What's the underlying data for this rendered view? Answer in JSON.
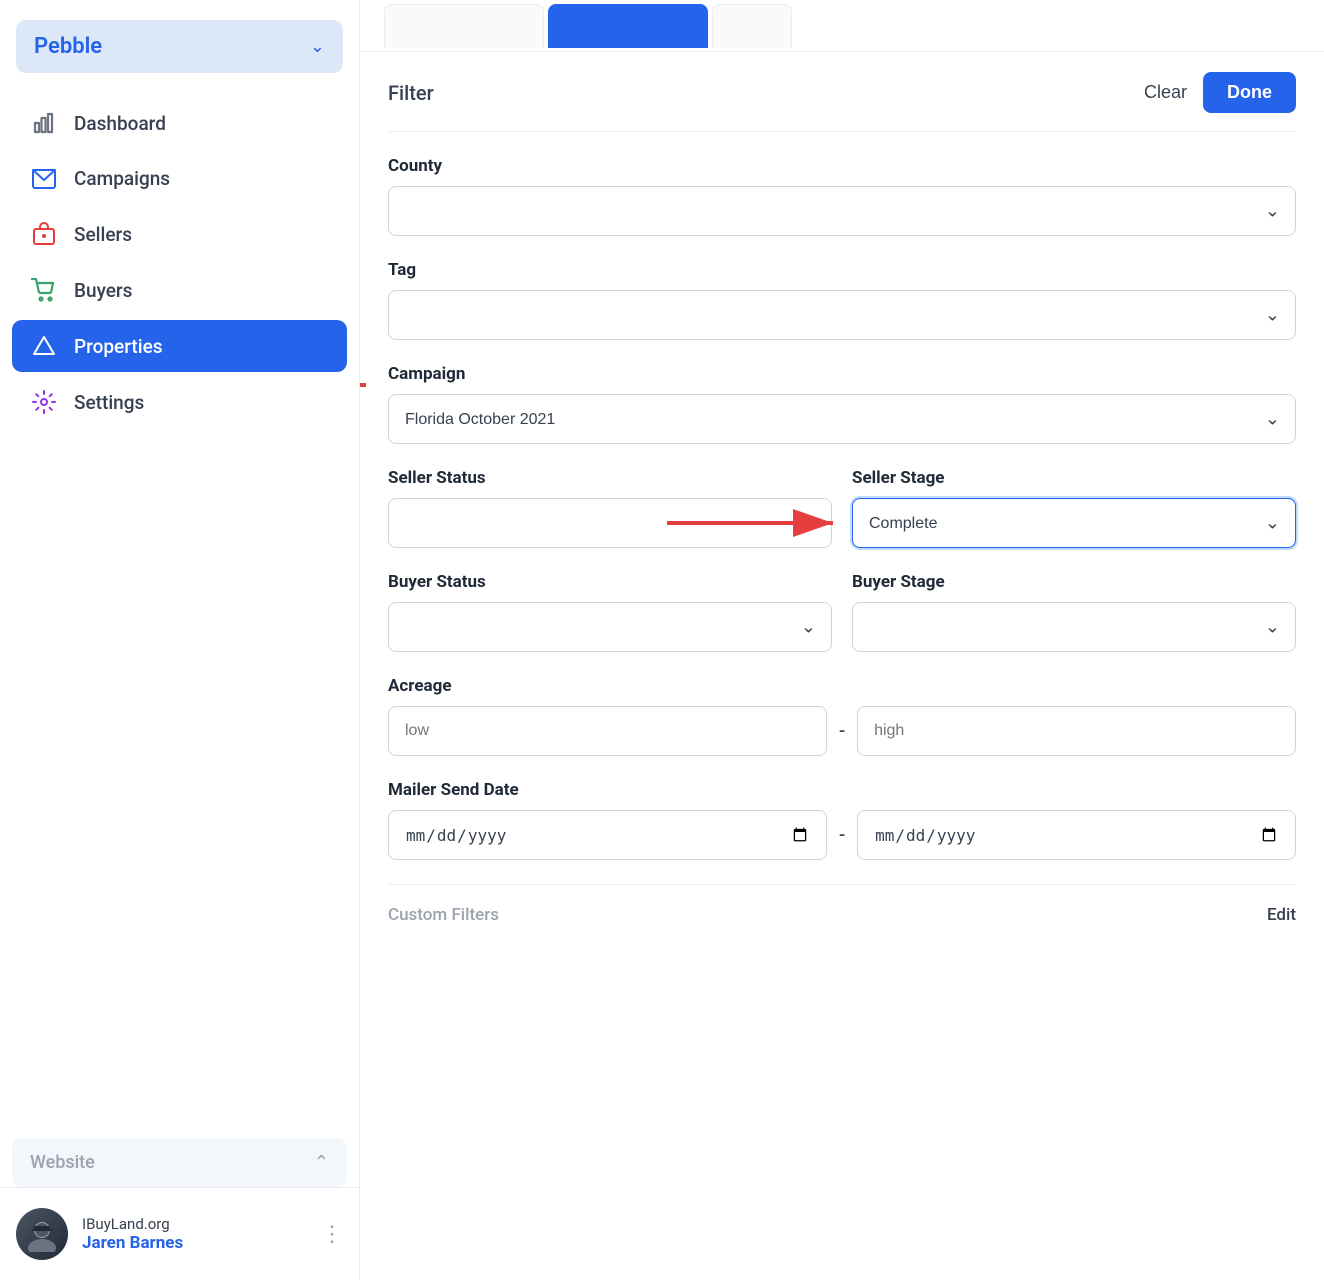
{
  "sidebar": {
    "brand": {
      "name": "Pebble",
      "chevron": "chevron-down"
    },
    "nav_items": [
      {
        "id": "dashboard",
        "label": "Dashboard",
        "icon": "bar-chart"
      },
      {
        "id": "campaigns",
        "label": "Campaigns",
        "icon": "mail"
      },
      {
        "id": "sellers",
        "label": "Sellers",
        "icon": "bag"
      },
      {
        "id": "buyers",
        "label": "Buyers",
        "icon": "cart"
      },
      {
        "id": "properties",
        "label": "Properties",
        "icon": "triangle",
        "active": true
      },
      {
        "id": "settings",
        "label": "Settings",
        "icon": "gear"
      }
    ],
    "section": {
      "label": "Website",
      "chevron": "chevron-up"
    },
    "footer": {
      "org": "IBuyLand.org",
      "name": "Jaren Barnes",
      "dots": "⋯"
    }
  },
  "tabs": [
    {
      "id": "tab1",
      "label": ""
    },
    {
      "id": "tab2",
      "label": "",
      "active": true
    },
    {
      "id": "tab3",
      "label": ""
    }
  ],
  "filter": {
    "title": "Filter",
    "clear_label": "Clear",
    "done_label": "Done",
    "fields": {
      "county": {
        "label": "County",
        "placeholder": ""
      },
      "tag": {
        "label": "Tag",
        "placeholder": ""
      },
      "campaign": {
        "label": "Campaign",
        "value": "Florida October 2021"
      },
      "seller_status": {
        "label": "Seller Status",
        "placeholder": ""
      },
      "seller_stage": {
        "label": "Seller Stage",
        "value": "Complete"
      },
      "buyer_status": {
        "label": "Buyer Status",
        "placeholder": ""
      },
      "buyer_stage": {
        "label": "Buyer Stage",
        "placeholder": ""
      },
      "acreage": {
        "label": "Acreage",
        "low_placeholder": "low",
        "high_placeholder": "high"
      },
      "mailer_send_date": {
        "label": "Mailer Send Date",
        "from_placeholder": "mm/dd/yyyy",
        "to_placeholder": "mm/dd/yyyy"
      }
    },
    "custom_filters": {
      "label": "Custom Filters",
      "edit_label": "Edit"
    }
  }
}
